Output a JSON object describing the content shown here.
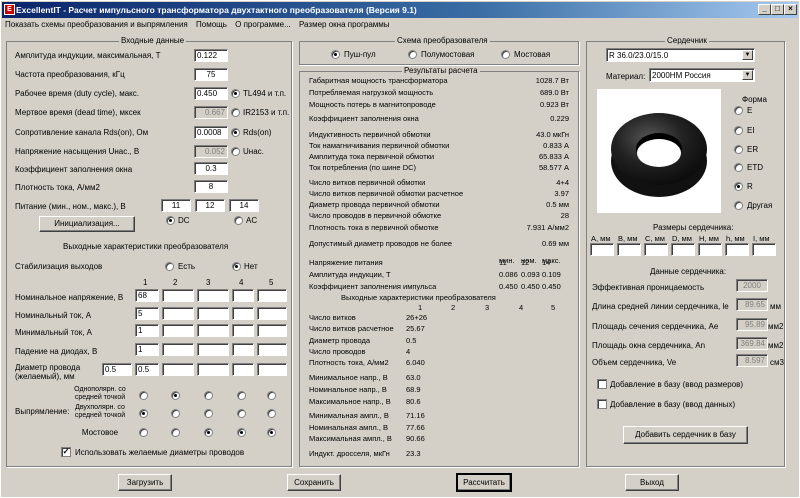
{
  "window": {
    "title": "ExcellentIT - Расчет импульсного трансформатора двухтактного преобразователя (Версия 9.1)"
  },
  "menu": [
    "Показать схемы преобразования и выпрямления",
    "Помощь",
    "О программе...",
    "Размер окна программы"
  ],
  "input": {
    "group_title": "Входные данные",
    "induction_label": "Амплитуда индукции, максимальная, Т",
    "induction": "0.122",
    "freq_label": "Частота преобразования, кГц",
    "freq": "75",
    "duty_label": "Рабочее время (duty cycle), макс.",
    "duty": "0.450",
    "tl494": "TL494 и т.п.",
    "dead_label": "Мертвое время (dead time), мксек",
    "dead": "0.667",
    "ir2153": "IR2153 и т.п.",
    "rds_label": "Сопротивление канала Rds(on), Ом",
    "rds": "0.0008",
    "rds_opt": "Rds(on)",
    "usat_label": "Напряжение насыщения Uнас., В",
    "usat": "0.052",
    "usat_opt": "Uнас.",
    "fill_label": "Коэффициент заполнения окна",
    "fill": "0.3",
    "current_label": "Плотность тока, А/мм2",
    "current": "8",
    "supply_label": "Питание (мин., ном., макс.), В",
    "supply": [
      "11",
      "12",
      "14"
    ],
    "init_button": "Инициализация...",
    "dc": "DC",
    "ac": "AC"
  },
  "output": {
    "group_title": "Выходные характеристики преобразователя",
    "stab_label": "Стабилизация выходов",
    "stab_yes": "Есть",
    "stab_no": "Нет",
    "cols": [
      "1",
      "2",
      "3",
      "4",
      "5"
    ],
    "rows": [
      {
        "label": "Номинальное напряжение, В",
        "values": [
          "68",
          "",
          "",
          "",
          ""
        ]
      },
      {
        "label": "Номинальный ток, А",
        "values": [
          "5",
          "",
          "",
          "",
          ""
        ]
      },
      {
        "label": "Минимальный ток, А",
        "values": [
          "1",
          "",
          "",
          "",
          ""
        ]
      },
      {
        "label": "Падение на диодах, В",
        "values": [
          "1",
          "",
          "",
          "",
          ""
        ]
      }
    ],
    "wire_label": "Диаметр провода (желаемый), мм",
    "wire_values": [
      "0.5",
      "0.5",
      "",
      "",
      ""
    ],
    "rect_label": "Выпрямление:",
    "rect_rows": [
      "Однополярн. со средней точкой",
      "Двухполярн. со средней точкой",
      "Мостовое"
    ],
    "use_wire_label": "Использовать желаемые диаметры проводов"
  },
  "scheme": {
    "title": "Схема преобразователя",
    "options": [
      "Пуш-пул",
      "Полумостовая",
      "Мостовая"
    ]
  },
  "results": {
    "title": "Результаты расчета",
    "lines": [
      {
        "k": "Габаритная мощность трансформатора",
        "v": "1028.7 Вт"
      },
      {
        "k": "Потребляемая нагрузкой мощность",
        "v": "689.0 Вт"
      },
      {
        "k": "Мощность потерь в магнитопроводе",
        "v": "0.923 Вт"
      },
      {
        "k": "Коэффициент заполнения окна",
        "v": "0.229"
      },
      {
        "k": "Индуктивность первичной обмотки",
        "v": "43.0 мкГн"
      },
      {
        "k": "Ток намагничивания первичной обмотки",
        "v": "0.833 А"
      },
      {
        "k": "Амплитуда тока первичной обмотки",
        "v": "65.833 А"
      },
      {
        "k": "Ток потребления (по шине DC)",
        "v": "58.577 А"
      },
      {
        "k": "Число витков первичной обмотки",
        "v": "4+4"
      },
      {
        "k": "Число витков первичной обмотки расчетное",
        "v": "3.97"
      },
      {
        "k": "Диаметр провода первичной обмотки",
        "v": "0.5 мм"
      },
      {
        "k": "Число проводов в первичной обмотке",
        "v": "28"
      },
      {
        "k": "Плотность тока в первичной обмотке",
        "v": "7.931 А/мм2"
      },
      {
        "k": "Допустимый диаметр проводов не более",
        "v": "0.69 мм"
      }
    ],
    "table_head": [
      "мин.",
      "ном.",
      "макс."
    ],
    "table_rows": [
      {
        "k": "Напряжение питания",
        "v": [
          "11",
          "12",
          "14"
        ]
      },
      {
        "k": "Амплитуда индукции, Т",
        "v": [
          "0.086",
          "0.093",
          "0.109"
        ]
      },
      {
        "k": "Коэффициент заполнения импульса",
        "v": [
          "0.450",
          "0.450",
          "0.450"
        ]
      }
    ],
    "out_title": "Выходные характеристики преобразователя",
    "out_cols": [
      "1",
      "2",
      "3",
      "4",
      "5"
    ],
    "out_rows": [
      {
        "k": "Число витков",
        "v": "26+26"
      },
      {
        "k": "Число витков расчетное",
        "v": "25.67"
      },
      {
        "k": "Диаметр провода",
        "v": "0.5"
      },
      {
        "k": "Число проводов",
        "v": "4"
      },
      {
        "k": "Плотность тока, А/мм2",
        "v": "6.040"
      },
      {
        "k": "Минимальное напр., В",
        "v": "63.0"
      },
      {
        "k": "Номинальное напр., В",
        "v": "68.9"
      },
      {
        "k": "Максимальное напр., В",
        "v": "80.6"
      },
      {
        "k": "Минимальная ампл., В",
        "v": "71.16"
      },
      {
        "k": "Номинальная ампл., В",
        "v": "77.66"
      },
      {
        "k": "Максимальная ампл., В",
        "v": "90.66"
      },
      {
        "k": "Индукт. дросселя, мкГн",
        "v": "23.3"
      }
    ]
  },
  "core": {
    "title": "Сердечник",
    "core_value": "R 36.0/23.0/15.0",
    "material_label": "Материал:",
    "material": "2000НМ Россия",
    "form_label": "Форма",
    "forms": [
      "E",
      "EI",
      "ER",
      "ETD",
      "R",
      "Другая"
    ],
    "dims_title": "Размеры сердечника:",
    "dims": [
      "A, мм",
      "B, мм",
      "C, мм",
      "D, мм",
      "H, мм",
      "h, мм",
      "I, мм"
    ],
    "data_title": "Данные сердечника:",
    "perm_label": "Эффективная проницаемость",
    "perm": "2000",
    "le_label": "Длина средней линии сердечника, le",
    "le": "89.65",
    "le_unit": "мм",
    "ae_label": "Площадь сечения сердечника, Ae",
    "ae": "95.89",
    "ae_unit": "мм2",
    "an_label": "Площадь окна сердечника, An",
    "an": "369.84",
    "an_unit": "мм2",
    "ve_label": "Объем сердечника, Ve",
    "ve": "8.597",
    "ve_unit": "см3",
    "add_dims": "Добавление в базу (ввод размеров)",
    "add_data": "Добавление в базу (ввод данных)",
    "add_button": "Добавить сердечник в базу"
  },
  "footer": {
    "load": "Загрузить",
    "save": "Сохранить",
    "calc": "Рассчитать",
    "exit": "Выход"
  }
}
